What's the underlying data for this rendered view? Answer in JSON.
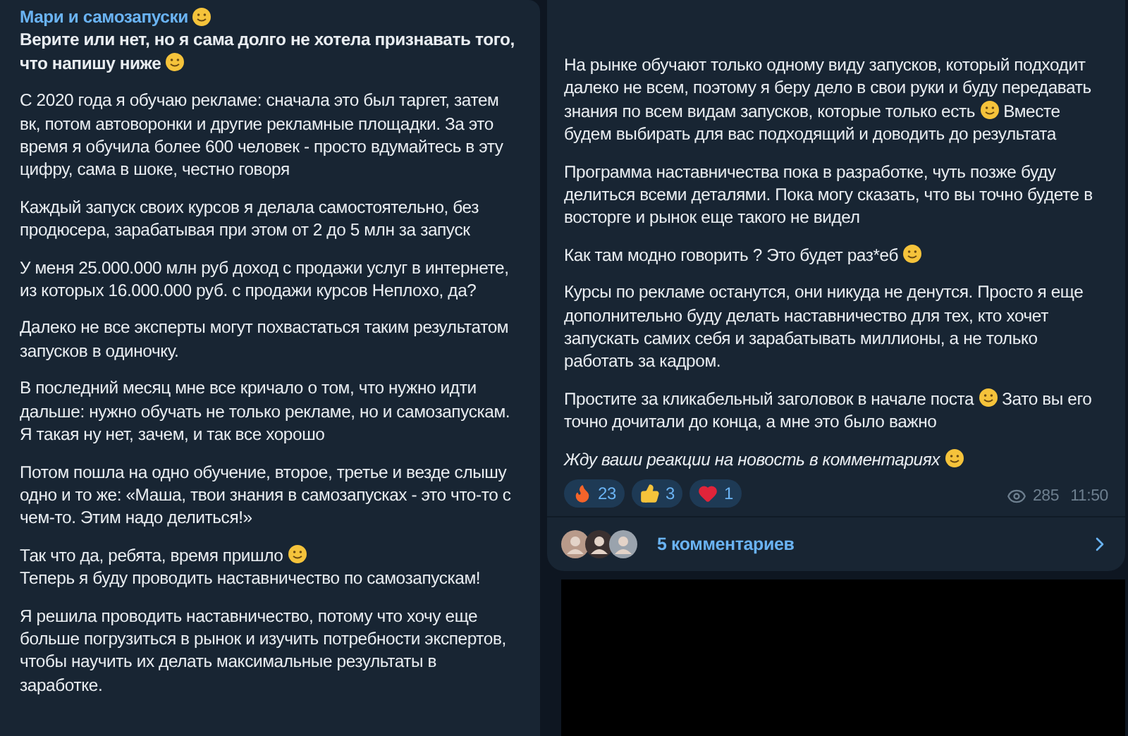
{
  "left_post": {
    "channel_name": "Мари и самозапуски",
    "paragraphs": [
      {
        "bold": true,
        "parts": [
          {
            "kind": "text",
            "text": "Верите или нет, но я сама долго не хотела признавать того, что напишу ниже"
          },
          {
            "kind": "emoji"
          }
        ]
      },
      {
        "bold": false,
        "parts": [
          {
            "kind": "text",
            "text": "С 2020 года я обучаю рекламе: сначала это был таргет, затем вк, потом автоворонки и другие рекламные площадки. За это время я обучила более 600 человек - просто вдумайтесь в эту цифру, сама в шоке, честно говоря"
          }
        ]
      },
      {
        "bold": false,
        "parts": [
          {
            "kind": "text",
            "text": "Каждый запуск своих курсов я делала самостоятельно, без продюсера, зарабатывая при этом от 2 до 5 млн за запуск"
          }
        ]
      },
      {
        "bold": false,
        "parts": [
          {
            "kind": "text",
            "text": "У меня 25.000.000 млн руб доход с продажи услуг в интернете, из которых 16.000.000 руб. с продажи курсов Неплохо, да?"
          }
        ]
      },
      {
        "bold": false,
        "parts": [
          {
            "kind": "text",
            "text": "Далеко не все эксперты  могут похвастаться таким результатом запусков в одиночку."
          }
        ]
      },
      {
        "bold": false,
        "parts": [
          {
            "kind": "text",
            "text": "В последний месяц мне все кричало о том, что нужно идти дальше: нужно обучать не только рекламе, но и самозапускам. Я такая ну нет, зачем, и так все хорошо"
          }
        ]
      },
      {
        "bold": false,
        "parts": [
          {
            "kind": "text",
            "text": "Потом пошла на одно обучение, второе, третье и везде слышу одно и то же: «Маша, твои знания в самозапусках - это что-то с чем-то. Этим надо делиться!»"
          }
        ]
      },
      {
        "bold": false,
        "parts": [
          {
            "kind": "text",
            "text": "Так что да, ребята, время пришло"
          },
          {
            "kind": "emoji"
          },
          {
            "kind": "break"
          },
          {
            "kind": "text",
            "text": "Теперь я буду проводить наставничество по самозапускам!"
          }
        ]
      },
      {
        "bold": false,
        "parts": [
          {
            "kind": "text",
            "text": "Я решила проводить наставничество, потому что хочу еще больше погрузиться в рынок и изучить потребности экспертов, чтобы научить их делать максимальные результаты в заработке."
          }
        ]
      }
    ]
  },
  "right_post": {
    "paragraphs": [
      {
        "italic": false,
        "parts": [
          {
            "kind": "text",
            "text": "На рынке обучают только одному виду запусков, который подходит далеко не всем, поэтому я беру дело в свои руки и буду передавать знания по всем видам запусков, которые только есть"
          },
          {
            "kind": "emoji"
          },
          {
            "kind": "text",
            "text": "Вместе будем выбирать для вас подходящий и доводить до результата"
          }
        ]
      },
      {
        "italic": false,
        "parts": [
          {
            "kind": "text",
            "text": "Программа наставничества пока в разработке, чуть позже буду делиться всеми деталями. Пока могу сказать, что вы точно будете в восторге и рынок еще такого не видел"
          }
        ]
      },
      {
        "italic": false,
        "parts": [
          {
            "kind": "text",
            "text": "Как там модно говорить ? Это будет раз*еб"
          },
          {
            "kind": "emoji"
          }
        ]
      },
      {
        "italic": false,
        "parts": [
          {
            "kind": "text",
            "text": "Курсы по рекламе останутся, они никуда не денутся. Просто я еще дополнительно буду делать наставничество для тех, кто хочет запускать самих себя и зарабатывать миллионы, а не только работать за кадром."
          }
        ]
      },
      {
        "italic": false,
        "parts": [
          {
            "kind": "text",
            "text": "Простите за кликабельный заголовок в начале поста"
          },
          {
            "kind": "emoji"
          },
          {
            "kind": "text",
            "text": "Зато вы его точно дочитали до конца, а мне это было важно"
          }
        ]
      },
      {
        "italic": true,
        "parts": [
          {
            "kind": "text",
            "text": "Жду ваши реакции на новость в комментариях"
          },
          {
            "kind": "emoji"
          }
        ]
      }
    ],
    "reactions": [
      {
        "count": "23",
        "selected": false
      },
      {
        "count": "3",
        "selected": false
      },
      {
        "count": "1",
        "selected": false
      }
    ],
    "views": "285",
    "time": "11:50",
    "comments": {
      "avatars": [
        {
          "kind": "avatar"
        },
        {
          "kind": "avatar"
        },
        {
          "kind": "avatar"
        }
      ],
      "label": "5 комментариев"
    }
  }
}
